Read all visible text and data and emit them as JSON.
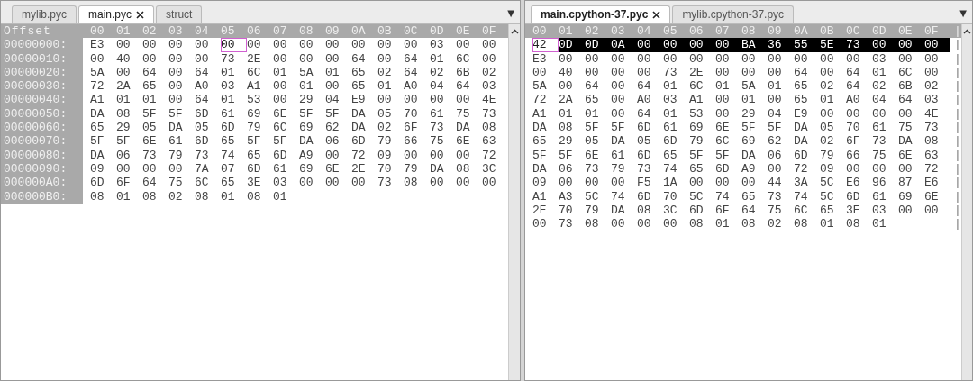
{
  "panes": [
    {
      "tabs": [
        {
          "label": "mylib.pyc",
          "selected": false,
          "closable": false
        },
        {
          "label": "main.pyc",
          "selected": true,
          "closable": true
        },
        {
          "label": "struct",
          "selected": false,
          "closable": false
        }
      ],
      "menu_glyph": "▼",
      "offset_heading": "Offset",
      "columns": [
        "00",
        "01",
        "02",
        "03",
        "04",
        "05",
        "06",
        "07",
        "08",
        "09",
        "0A",
        "0B",
        "0C",
        "0D",
        "0E",
        "0F"
      ],
      "rows": [
        {
          "offset": "00000000:",
          "bytes": [
            {
              "text": "E3",
              "selected": false,
              "cursor": false
            },
            {
              "text": "00",
              "selected": false,
              "cursor": false
            },
            {
              "text": "00",
              "selected": false,
              "cursor": false
            },
            {
              "text": "00",
              "selected": false,
              "cursor": false
            },
            {
              "text": "00",
              "selected": false,
              "cursor": false
            },
            {
              "text": "00",
              "selected": false,
              "cursor": true
            },
            {
              "text": "00",
              "selected": false,
              "cursor": false
            },
            {
              "text": "00",
              "selected": false,
              "cursor": false
            },
            {
              "text": "00",
              "selected": false,
              "cursor": false
            },
            {
              "text": "00",
              "selected": false,
              "cursor": false
            },
            {
              "text": "00",
              "selected": false,
              "cursor": false
            },
            {
              "text": "00",
              "selected": false,
              "cursor": false
            },
            {
              "text": "00",
              "selected": false,
              "cursor": false
            },
            {
              "text": "03",
              "selected": false,
              "cursor": false
            },
            {
              "text": "00",
              "selected": false,
              "cursor": false
            },
            {
              "text": "00",
              "selected": false,
              "cursor": false
            }
          ]
        },
        {
          "offset": "00000010:",
          "bytes": [
            "00",
            "40",
            "00",
            "00",
            "00",
            "73",
            "2E",
            "00",
            "00",
            "00",
            "64",
            "00",
            "64",
            "01",
            "6C",
            "00"
          ]
        },
        {
          "offset": "00000020:",
          "bytes": [
            "5A",
            "00",
            "64",
            "00",
            "64",
            "01",
            "6C",
            "01",
            "5A",
            "01",
            "65",
            "02",
            "64",
            "02",
            "6B",
            "02"
          ]
        },
        {
          "offset": "00000030:",
          "bytes": [
            "72",
            "2A",
            "65",
            "00",
            "A0",
            "03",
            "A1",
            "00",
            "01",
            "00",
            "65",
            "01",
            "A0",
            "04",
            "64",
            "03"
          ]
        },
        {
          "offset": "00000040:",
          "bytes": [
            "A1",
            "01",
            "01",
            "00",
            "64",
            "01",
            "53",
            "00",
            "29",
            "04",
            "E9",
            "00",
            "00",
            "00",
            "00",
            "4E"
          ]
        },
        {
          "offset": "00000050:",
          "bytes": [
            "DA",
            "08",
            "5F",
            "5F",
            "6D",
            "61",
            "69",
            "6E",
            "5F",
            "5F",
            "DA",
            "05",
            "70",
            "61",
            "75",
            "73"
          ]
        },
        {
          "offset": "00000060:",
          "bytes": [
            "65",
            "29",
            "05",
            "DA",
            "05",
            "6D",
            "79",
            "6C",
            "69",
            "62",
            "DA",
            "02",
            "6F",
            "73",
            "DA",
            "08"
          ]
        },
        {
          "offset": "00000070:",
          "bytes": [
            "5F",
            "5F",
            "6E",
            "61",
            "6D",
            "65",
            "5F",
            "5F",
            "DA",
            "06",
            "6D",
            "79",
            "66",
            "75",
            "6E",
            "63"
          ]
        },
        {
          "offset": "00000080:",
          "bytes": [
            "DA",
            "06",
            "73",
            "79",
            "73",
            "74",
            "65",
            "6D",
            "A9",
            "00",
            "72",
            "09",
            "00",
            "00",
            "00",
            "72"
          ]
        },
        {
          "offset": "00000090:",
          "bytes": [
            "09",
            "00",
            "00",
            "00",
            "7A",
            "07",
            "6D",
            "61",
            "69",
            "6E",
            "2E",
            "70",
            "79",
            "DA",
            "08",
            "3C"
          ]
        },
        {
          "offset": "000000A0:",
          "bytes": [
            "6D",
            "6F",
            "64",
            "75",
            "6C",
            "65",
            "3E",
            "03",
            "00",
            "00",
            "00",
            "73",
            "08",
            "00",
            "00",
            "00"
          ]
        },
        {
          "offset": "000000B0:",
          "bytes": [
            "08",
            "01",
            "08",
            "02",
            "08",
            "01",
            "08",
            "01"
          ]
        }
      ]
    },
    {
      "tabs": [
        {
          "label": "main.cpython-37.pyc",
          "selected": true,
          "closable": true
        },
        {
          "label": "mylib.cpython-37.pyc",
          "selected": false,
          "closable": false
        }
      ],
      "menu_glyph": "▼",
      "ascii_edge": "|",
      "columns": [
        "00",
        "01",
        "02",
        "03",
        "04",
        "05",
        "06",
        "07",
        "08",
        "09",
        "0A",
        "0B",
        "0C",
        "0D",
        "0E",
        "0F"
      ],
      "rows": [
        {
          "bytes": [
            {
              "text": "42",
              "selected": false,
              "cursor": true
            },
            {
              "text": "0D",
              "selected": true,
              "cursor": false
            },
            {
              "text": "0D",
              "selected": true,
              "cursor": false
            },
            {
              "text": "0A",
              "selected": true,
              "cursor": false
            },
            {
              "text": "00",
              "selected": true,
              "cursor": false
            },
            {
              "text": "00",
              "selected": true,
              "cursor": false
            },
            {
              "text": "00",
              "selected": true,
              "cursor": false
            },
            {
              "text": "00",
              "selected": true,
              "cursor": false
            },
            {
              "text": "BA",
              "selected": true,
              "cursor": false
            },
            {
              "text": "36",
              "selected": true,
              "cursor": false
            },
            {
              "text": "55",
              "selected": true,
              "cursor": false
            },
            {
              "text": "5E",
              "selected": true,
              "cursor": false
            },
            {
              "text": "73",
              "selected": true,
              "cursor": false
            },
            {
              "text": "00",
              "selected": true,
              "cursor": false
            },
            {
              "text": "00",
              "selected": true,
              "cursor": false
            },
            {
              "text": "00",
              "selected": true,
              "cursor": false
            }
          ]
        },
        {
          "bytes": [
            "E3",
            "00",
            "00",
            "00",
            "00",
            "00",
            "00",
            "00",
            "00",
            "00",
            "00",
            "00",
            "00",
            "03",
            "00",
            "00"
          ]
        },
        {
          "bytes": [
            "00",
            "40",
            "00",
            "00",
            "00",
            "73",
            "2E",
            "00",
            "00",
            "00",
            "64",
            "00",
            "64",
            "01",
            "6C",
            "00"
          ]
        },
        {
          "bytes": [
            "5A",
            "00",
            "64",
            "00",
            "64",
            "01",
            "6C",
            "01",
            "5A",
            "01",
            "65",
            "02",
            "64",
            "02",
            "6B",
            "02"
          ]
        },
        {
          "bytes": [
            "72",
            "2A",
            "65",
            "00",
            "A0",
            "03",
            "A1",
            "00",
            "01",
            "00",
            "65",
            "01",
            "A0",
            "04",
            "64",
            "03"
          ]
        },
        {
          "bytes": [
            "A1",
            "01",
            "01",
            "00",
            "64",
            "01",
            "53",
            "00",
            "29",
            "04",
            "E9",
            "00",
            "00",
            "00",
            "00",
            "4E"
          ]
        },
        {
          "bytes": [
            "DA",
            "08",
            "5F",
            "5F",
            "6D",
            "61",
            "69",
            "6E",
            "5F",
            "5F",
            "DA",
            "05",
            "70",
            "61",
            "75",
            "73"
          ]
        },
        {
          "bytes": [
            "65",
            "29",
            "05",
            "DA",
            "05",
            "6D",
            "79",
            "6C",
            "69",
            "62",
            "DA",
            "02",
            "6F",
            "73",
            "DA",
            "08"
          ]
        },
        {
          "bytes": [
            "5F",
            "5F",
            "6E",
            "61",
            "6D",
            "65",
            "5F",
            "5F",
            "DA",
            "06",
            "6D",
            "79",
            "66",
            "75",
            "6E",
            "63"
          ]
        },
        {
          "bytes": [
            "DA",
            "06",
            "73",
            "79",
            "73",
            "74",
            "65",
            "6D",
            "A9",
            "00",
            "72",
            "09",
            "00",
            "00",
            "00",
            "72"
          ]
        },
        {
          "bytes": [
            "09",
            "00",
            "00",
            "00",
            "F5",
            "1A",
            "00",
            "00",
            "00",
            "44",
            "3A",
            "5C",
            "E6",
            "96",
            "87",
            "E6"
          ]
        },
        {
          "bytes": [
            "A1",
            "A3",
            "5C",
            "74",
            "6D",
            "70",
            "5C",
            "74",
            "65",
            "73",
            "74",
            "5C",
            "6D",
            "61",
            "69",
            "6E"
          ]
        },
        {
          "bytes": [
            "2E",
            "70",
            "79",
            "DA",
            "08",
            "3C",
            "6D",
            "6F",
            "64",
            "75",
            "6C",
            "65",
            "3E",
            "03",
            "00",
            "00"
          ]
        },
        {
          "bytes": [
            "00",
            "73",
            "08",
            "00",
            "00",
            "00",
            "08",
            "01",
            "08",
            "02",
            "08",
            "01",
            "08",
            "01"
          ]
        }
      ]
    }
  ]
}
